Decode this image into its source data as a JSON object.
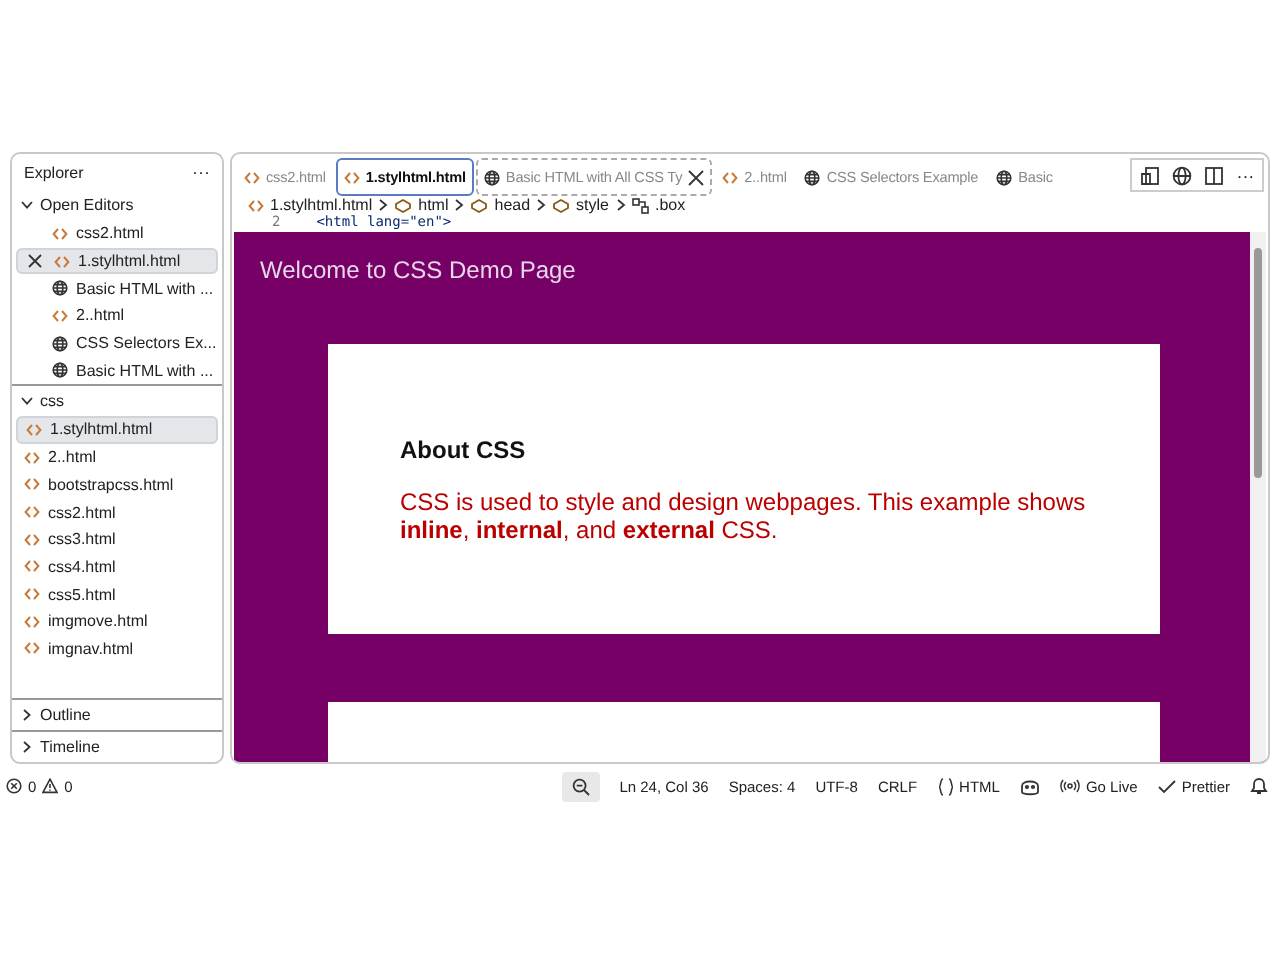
{
  "explorer": {
    "title": "Explorer",
    "more": "···",
    "open_editors": {
      "label": "Open Editors",
      "expanded": true,
      "items": [
        {
          "name": "css2.html",
          "kind": "html",
          "selected": false
        },
        {
          "name": "1.stylhtml.html",
          "kind": "html",
          "selected": true
        },
        {
          "name": "Basic HTML with ...",
          "kind": "preview",
          "selected": false
        },
        {
          "name": "2..html",
          "kind": "html",
          "selected": false
        },
        {
          "name": "CSS Selectors Ex...",
          "kind": "preview",
          "selected": false
        },
        {
          "name": "Basic HTML with ...",
          "kind": "preview",
          "selected": false
        }
      ]
    },
    "folder": {
      "label": "css",
      "expanded": true,
      "items": [
        {
          "name": "1.stylhtml.html",
          "selected": true
        },
        {
          "name": "2..html",
          "selected": false
        },
        {
          "name": "bootstrapcss.html",
          "selected": false
        },
        {
          "name": "css2.html",
          "selected": false
        },
        {
          "name": "css3.html",
          "selected": false
        },
        {
          "name": "css4.html",
          "selected": false
        },
        {
          "name": "css5.html",
          "selected": false
        },
        {
          "name": "imgmove.html",
          "selected": false
        },
        {
          "name": "imgnav.html",
          "selected": false
        }
      ]
    },
    "sections": [
      {
        "label": "Outline",
        "expanded": false
      },
      {
        "label": "Timeline",
        "expanded": false
      }
    ]
  },
  "tabs": [
    {
      "label": "css2.html",
      "kind": "html",
      "selected": false
    },
    {
      "label": "1.stylhtml.html",
      "kind": "html",
      "selected": true
    },
    {
      "label": "Basic HTML with All CSS Ty",
      "kind": "preview",
      "selected": false
    },
    {
      "label": "2..html",
      "kind": "html",
      "selected": false
    },
    {
      "label": "CSS Selectors Example",
      "kind": "preview",
      "selected": false
    },
    {
      "label": "Basic",
      "kind": "preview",
      "selected": false
    }
  ],
  "editor_more": "···",
  "breadcrumb": [
    {
      "label": "1.stylhtml.html",
      "kind": "file"
    },
    {
      "label": "html",
      "kind": "element"
    },
    {
      "label": "head",
      "kind": "element"
    },
    {
      "label": "style",
      "kind": "element"
    },
    {
      "label": ".box",
      "kind": "selector"
    }
  ],
  "code": {
    "line_number": "2",
    "text": "<html lang=\"en\">"
  },
  "preview": {
    "header": "Welcome to CSS Demo Page",
    "card": {
      "heading": "About CSS",
      "text": "CSS is used to style and design webpages. This example shows **inline**, **internal**, and **external** CSS."
    }
  },
  "status_bar": {
    "errors": "0",
    "warnings": "0",
    "position": "Ln 24, Col 36",
    "spaces": "Spaces: 4",
    "encoding": "UTF-8",
    "eol": "CRLF",
    "language": "HTML",
    "go_live": "Go Live",
    "prettier": "Prettier"
  }
}
